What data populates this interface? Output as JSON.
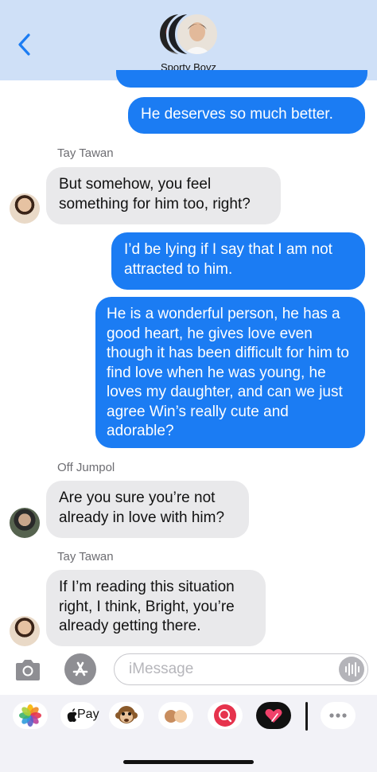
{
  "header": {
    "group_name": "Sporty Boyz"
  },
  "messages": [
    {
      "text": "He deserves so much better."
    },
    {
      "sender": "Tay Tawan",
      "text": "But somehow, you feel something for him too, right?"
    },
    {
      "text": "I’d be lying if I say that I am not attracted to him."
    },
    {
      "text": "He is a wonderful person, he has a good heart, he gives love even though it has been difficult for him to find love when he was young, he loves my daughter, and can we just agree Win’s really cute and adorable?"
    },
    {
      "sender": "Off Jumpol",
      "text": "Are you sure you’re not already in love with him?"
    },
    {
      "sender": "Tay Tawan",
      "text": "If I’m reading this situation right, I think, Bright, you’re already getting there."
    }
  ],
  "compose": {
    "placeholder": "iMessage"
  },
  "drawer": {
    "apps": [
      "photos-icon",
      "apple-pay-icon",
      "animoji-icon",
      "memoji-icon",
      "web-search-icon",
      "digital-touch-icon",
      "more-icon"
    ],
    "apple_pay_label": "Pay"
  },
  "colors": {
    "header_bg": "#cfe0f7",
    "outgoing_bubble": "#1b7cf3",
    "incoming_bubble": "#e9e9eb"
  }
}
